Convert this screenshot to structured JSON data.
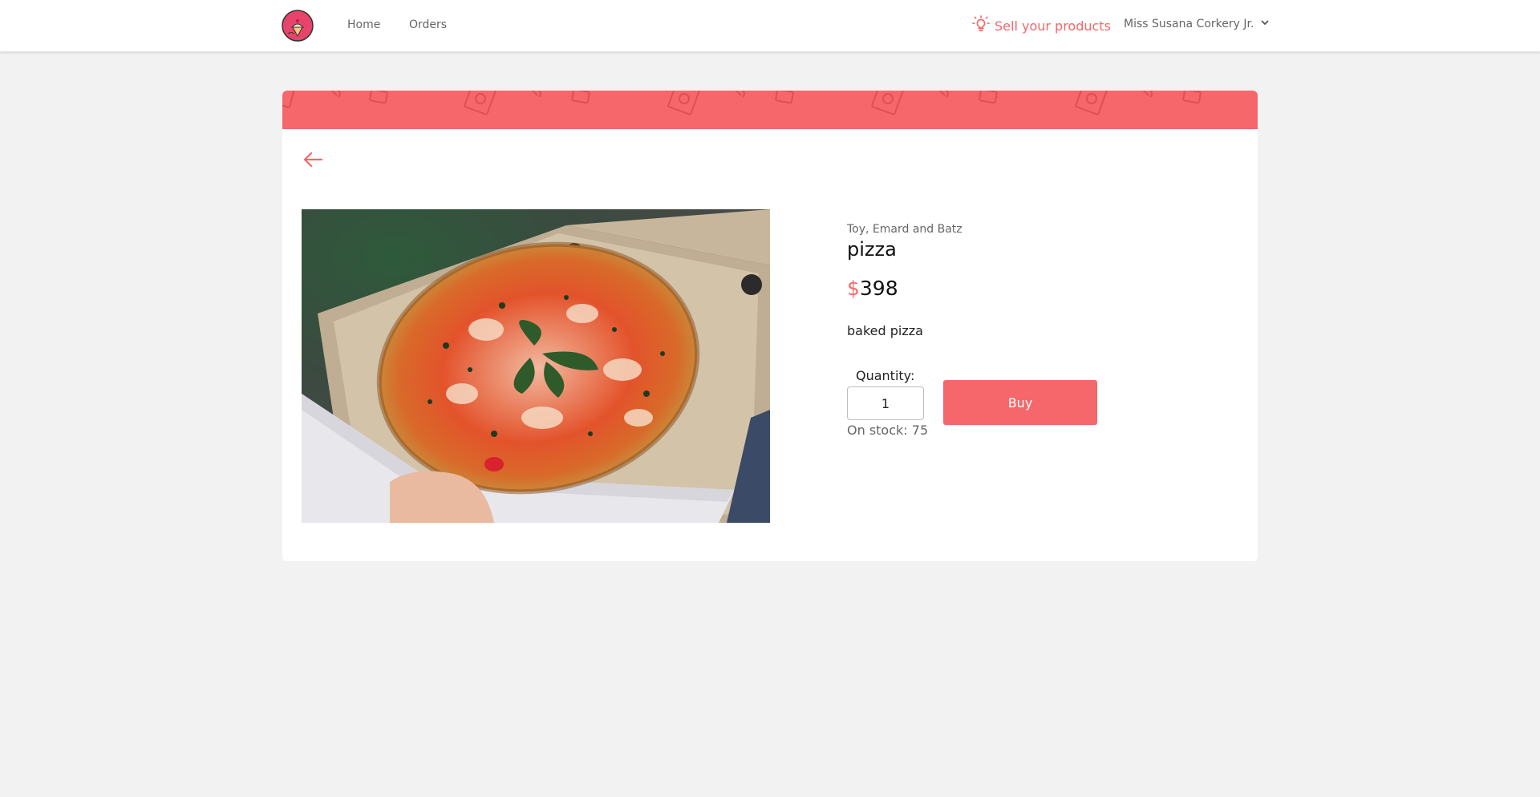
{
  "nav": {
    "logo_icon": "ice-cream-logo-icon",
    "home_label": "Home",
    "orders_label": "Orders",
    "sell_label": "Sell your products",
    "sell_icon": "lightbulb-icon",
    "user_name": "Miss Susana Corkery Jr.",
    "user_menu_icon": "chevron-down-icon"
  },
  "product": {
    "company": "Toy, Emard and Batz",
    "name": "pizza",
    "currency": "$",
    "price": "398",
    "description": "baked pizza",
    "quantity_label": "Quantity:",
    "quantity_value": "1",
    "stock_text": "On stock: 75",
    "buy_label": "Buy",
    "image_icon": "pizza-photo"
  },
  "colors": {
    "accent": "#f5676a",
    "background": "#f2f2f2",
    "card": "#ffffff"
  }
}
